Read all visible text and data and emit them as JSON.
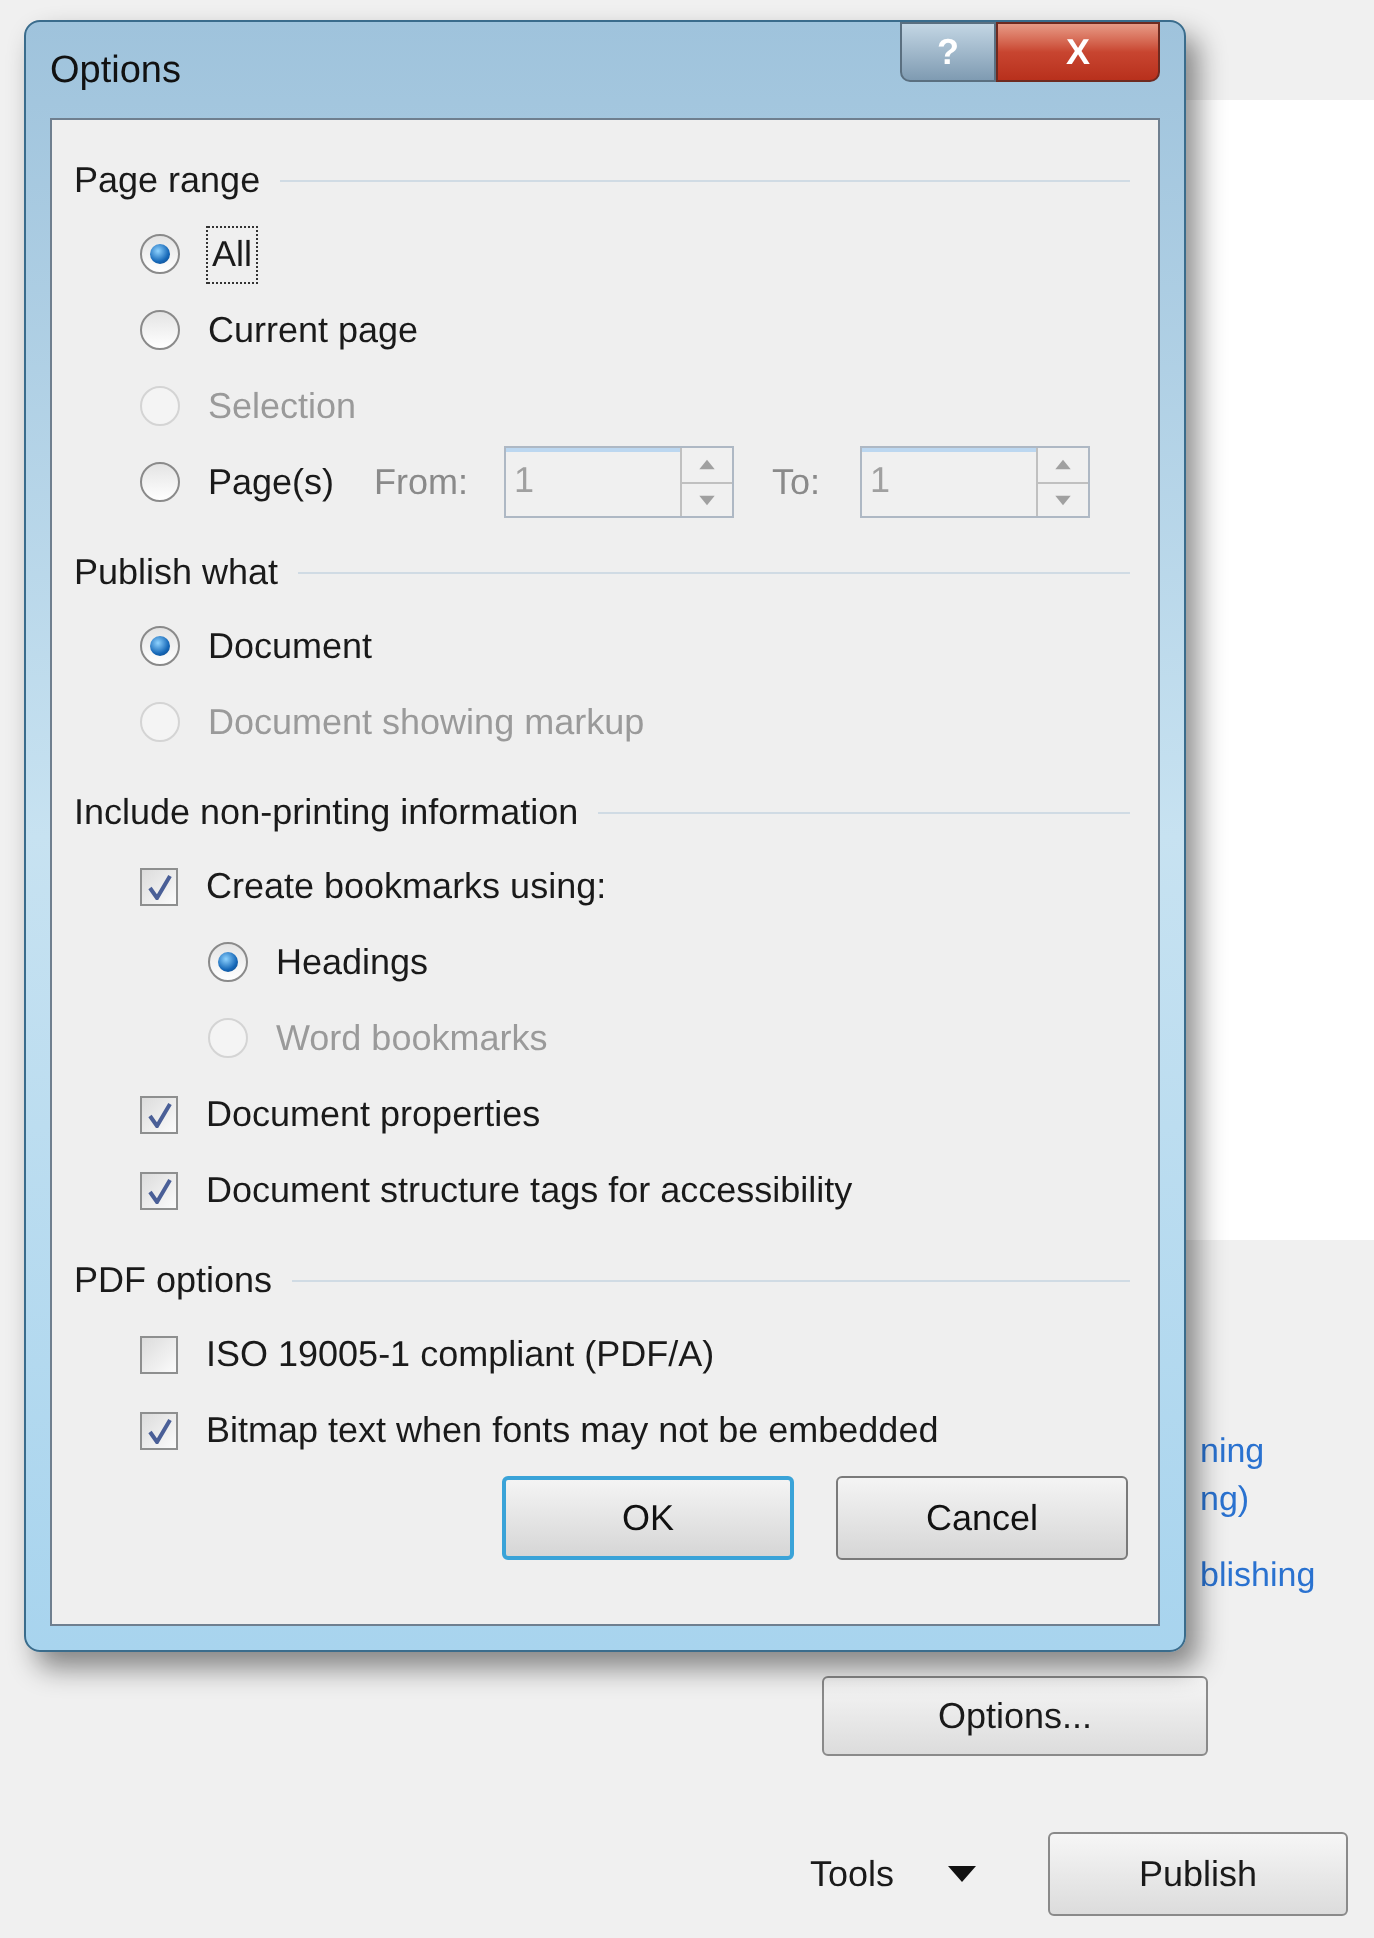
{
  "window": {
    "title": "Options"
  },
  "title_buttons": {
    "help": "?",
    "close": "X"
  },
  "sections": [
    {
      "title": "Page range",
      "items": [
        {
          "kind": "radio",
          "label": "All",
          "selected": true,
          "disabled": false,
          "focused": true
        },
        {
          "kind": "radio",
          "label": "Current page",
          "selected": false,
          "disabled": false,
          "focused": false
        },
        {
          "kind": "radio",
          "label": "Selection",
          "selected": false,
          "disabled": true,
          "focused": false
        },
        {
          "kind": "range",
          "label": "Page(s)",
          "selected": false,
          "disabled": false,
          "focused": false,
          "from_label": "From:",
          "from_value": "1",
          "to_label": "To:",
          "to_value": "1",
          "fields_disabled": true
        }
      ]
    },
    {
      "title": "Publish what",
      "items": [
        {
          "kind": "radio",
          "label": "Document",
          "selected": true,
          "disabled": false,
          "focused": false
        },
        {
          "kind": "radio",
          "label": "Document showing markup",
          "selected": false,
          "disabled": true,
          "focused": false
        }
      ]
    },
    {
      "title": "Include non-printing information",
      "items": [
        {
          "kind": "checkbox",
          "label": "Create bookmarks using:",
          "checked": true,
          "disabled": false,
          "children": [
            {
              "kind": "radio",
              "label": "Headings",
              "selected": true,
              "disabled": false,
              "focused": false
            },
            {
              "kind": "radio",
              "label": "Word bookmarks",
              "selected": false,
              "disabled": true,
              "focused": false
            }
          ]
        },
        {
          "kind": "checkbox",
          "label": "Document properties",
          "checked": true,
          "disabled": false
        },
        {
          "kind": "checkbox",
          "label": "Document structure tags for accessibility",
          "checked": true,
          "disabled": false
        }
      ]
    },
    {
      "title": "PDF options",
      "items": [
        {
          "kind": "checkbox",
          "label": "ISO 19005-1 compliant (PDF/A)",
          "checked": false,
          "disabled": false
        },
        {
          "kind": "checkbox",
          "label": "Bitmap text when fonts may not be embedded",
          "checked": true,
          "disabled": false
        }
      ]
    }
  ],
  "buttons": [
    {
      "label": "OK",
      "default": true
    },
    {
      "label": "Cancel",
      "default": false
    }
  ],
  "background": {
    "links": [
      "ning",
      "ng)",
      "blishing"
    ],
    "options_button": "Options...",
    "tools_label": "Tools",
    "publish_button": "Publish"
  }
}
